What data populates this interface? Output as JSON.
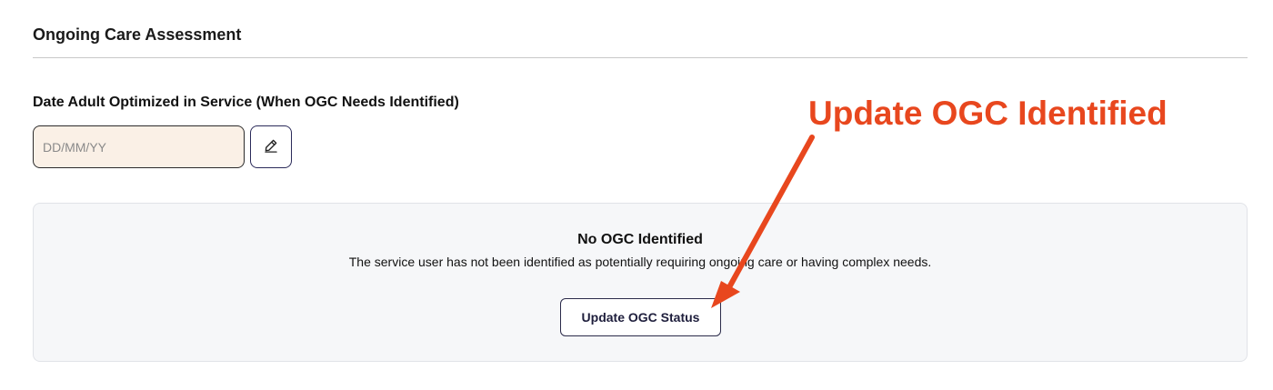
{
  "section": {
    "title": "Ongoing Care Assessment"
  },
  "date_field": {
    "label": "Date Adult Optimized in Service (When OGC Needs Identified)",
    "placeholder": "DD/MM/YY",
    "value": "",
    "edit_icon": "pencil-icon"
  },
  "status_panel": {
    "heading": "No OGC Identified",
    "description": "The service user has not been identified as potentially requiring ongoing care or having complex needs.",
    "button_label": "Update OGC Status"
  },
  "annotation": {
    "text": "Update OGC Identified",
    "color": "#e8471e"
  },
  "colors": {
    "input_background": "#faf0e6",
    "panel_background": "#f6f7f9",
    "button_border": "#2b2b4a"
  }
}
